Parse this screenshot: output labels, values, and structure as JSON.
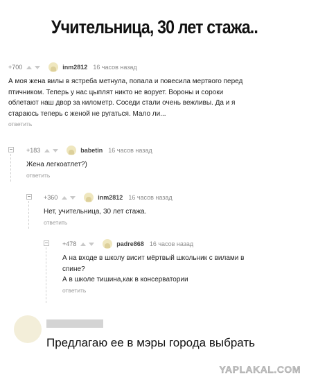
{
  "title": "Учительница, 30 лет стажа..",
  "comments": [
    {
      "rating": "+700",
      "author": "inm2812",
      "time": "16 часов назад",
      "lines": [
        "А моя жена вилы в ястреба метнула, попала и повесила мертвого перед",
        "птичником. Теперь у нас цыплят никто не ворует. Вороны и сороки",
        "облетают наш двор за километр. Соседи стали очень вежливы. Да и я",
        "стараюсь теперь с женой не ругаться. Мало ли..."
      ],
      "reply": "ответить"
    },
    {
      "rating": "+183",
      "author": "babetin",
      "time": "16 часов назад",
      "lines": [
        "Жена легкоатлет?)"
      ],
      "reply": "ответить"
    },
    {
      "rating": "+360",
      "author": "inm2812",
      "time": "16 часов назад",
      "lines": [
        "Нет, учительница, 30 лет стажа."
      ],
      "reply": "ответить"
    },
    {
      "rating": "+478",
      "author": "padre868",
      "time": "16 часов назад",
      "lines": [
        "А на входе в школу висит мёртвый школьник с вилами в",
        "спине?",
        "А в школе тишина,как в консерватории"
      ],
      "reply": "ответить"
    }
  ],
  "bottom_comment": "Предлагаю ее в мэры города выбрать",
  "watermark": "YAPLAKAL.COM",
  "colors": {
    "meta": "#8a8a8a",
    "reply": "#9a9a9a",
    "text": "#222222"
  }
}
